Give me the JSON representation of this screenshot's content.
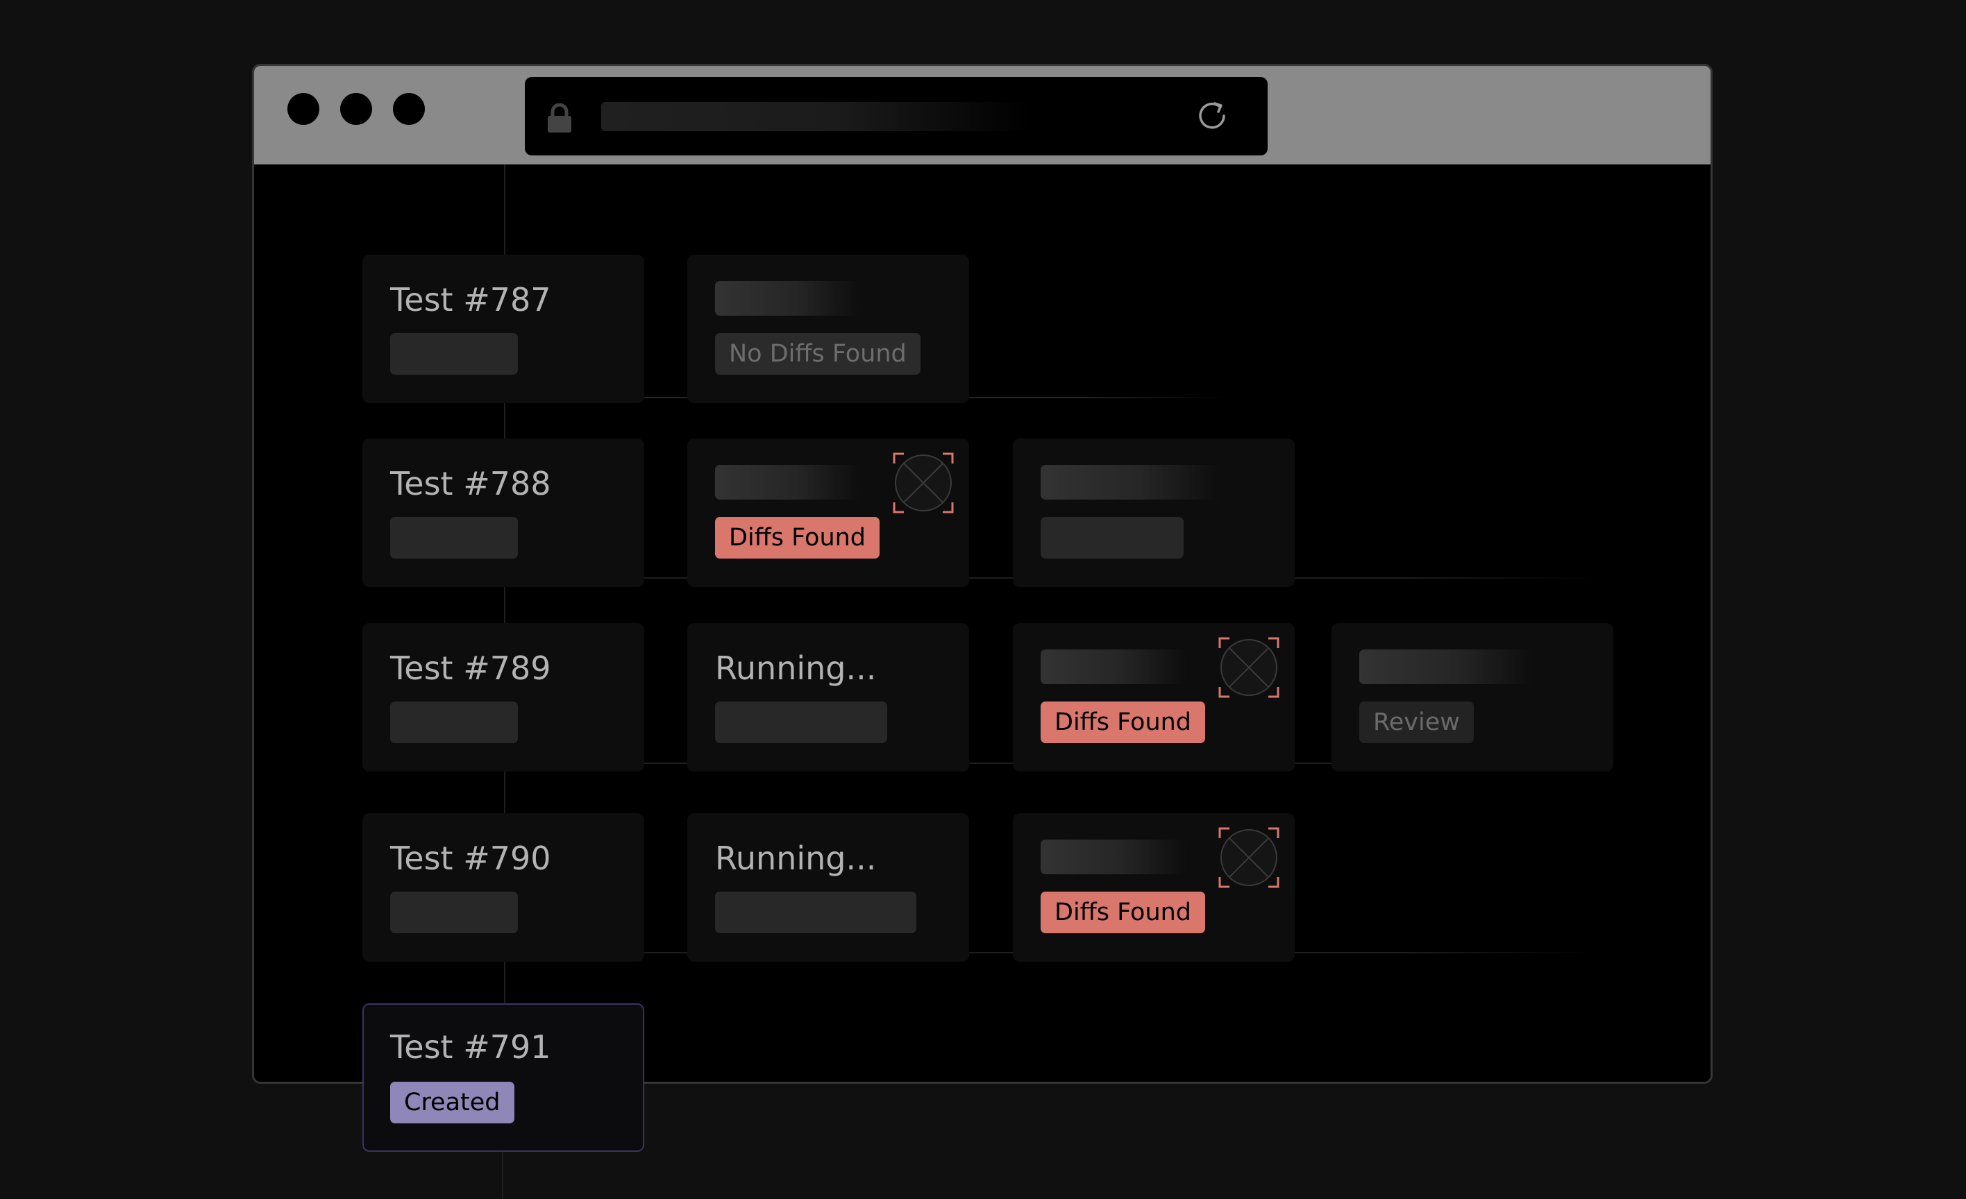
{
  "rows": [
    {
      "test_label": "Test #787",
      "stages": [
        {
          "title": "",
          "badge": "No Diffs Found",
          "status": "no-diffs"
        }
      ]
    },
    {
      "test_label": "Test #788",
      "stages": [
        {
          "title": "",
          "badge": "Diffs Found",
          "status": "diffs"
        },
        {
          "title": "",
          "badge": "",
          "status": "pending"
        }
      ]
    },
    {
      "test_label": "Test #789",
      "stages": [
        {
          "title": "Running...",
          "badge": "",
          "status": "running"
        },
        {
          "title": "",
          "badge": "Diffs Found",
          "status": "diffs"
        },
        {
          "title": "",
          "badge": "Review",
          "status": "review"
        }
      ]
    },
    {
      "test_label": "Test #790",
      "stages": [
        {
          "title": "Running...",
          "badge": "",
          "status": "running"
        },
        {
          "title": "",
          "badge": "Diffs Found",
          "status": "diffs"
        }
      ]
    },
    {
      "test_label": "Test #791",
      "badge": "Created",
      "status": "created"
    }
  ],
  "icons": {
    "window_controls": [
      "close-dot",
      "minimize-dot",
      "maximize-dot"
    ],
    "address_bar": [
      "lock-icon",
      "reload-icon"
    ],
    "diff": "diff-marker-icon"
  },
  "colors": {
    "diffs_found": "#d9776c",
    "created": "#8e87b8",
    "created_border": "#3b3461",
    "chrome": "#8a8a8a"
  }
}
